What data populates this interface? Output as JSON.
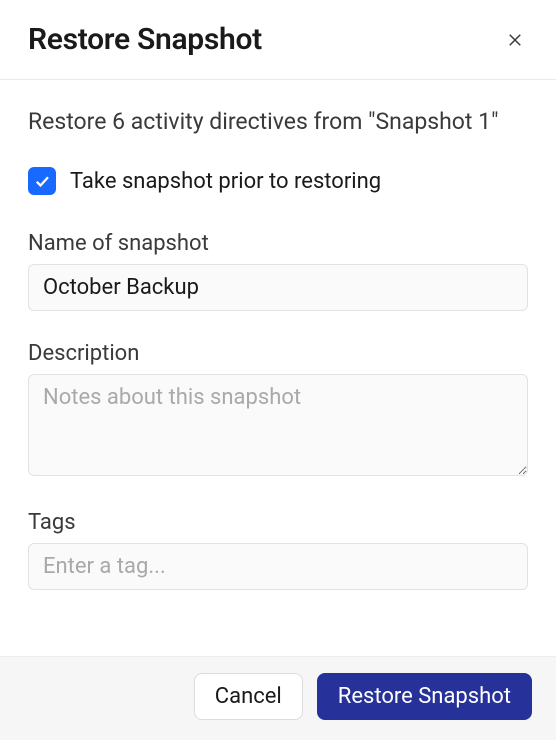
{
  "header": {
    "title": "Restore Snapshot"
  },
  "subtitle": "Restore 6 activity directives from \"Snapshot 1\"",
  "checkbox": {
    "checked": true,
    "label": "Take snapshot prior to restoring"
  },
  "fields": {
    "name": {
      "label": "Name of snapshot",
      "value": "October Backup",
      "placeholder": ""
    },
    "description": {
      "label": "Description",
      "value": "",
      "placeholder": "Notes about this snapshot"
    },
    "tags": {
      "label": "Tags",
      "value": "",
      "placeholder": "Enter a tag..."
    }
  },
  "footer": {
    "cancel": "Cancel",
    "confirm": "Restore Snapshot"
  }
}
